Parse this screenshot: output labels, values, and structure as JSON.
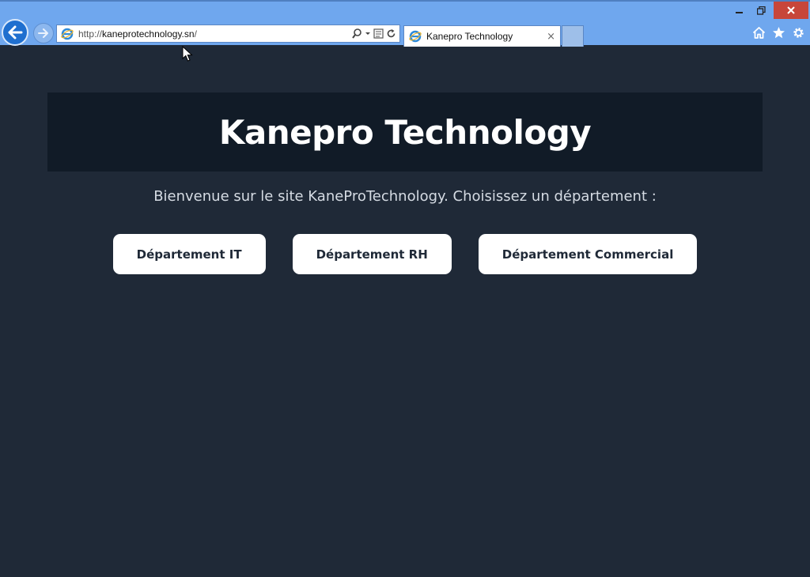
{
  "browser": {
    "url_prefix": "http://",
    "url_domain": "kaneprotechnology.sn",
    "url_suffix": "/",
    "tab_title": "Kanepro Technology",
    "tab_close": "×",
    "icons": [
      "back-arrow-icon",
      "forward-arrow-icon",
      "ie-logo-icon",
      "search-icon",
      "dropdown-icon",
      "compatibility-view-icon",
      "refresh-icon",
      "home-icon",
      "favorites-star-icon",
      "settings-gear-icon",
      "minimize-icon",
      "restore-icon",
      "close-icon"
    ]
  },
  "page": {
    "title": "Kanepro Technology",
    "welcome": "Bienvenue sur le site KaneProTechnology. Choisissez un département :",
    "departments": [
      {
        "label": "Département IT"
      },
      {
        "label": "Département RH"
      },
      {
        "label": "Département Commercial"
      }
    ]
  },
  "colors": {
    "page_background": "#1f2937",
    "header_band": "#111b27",
    "button_background": "#ffffff",
    "button_text": "#1f2937",
    "chrome_blue": "#6fa7ee",
    "close_red": "#c7463a"
  }
}
